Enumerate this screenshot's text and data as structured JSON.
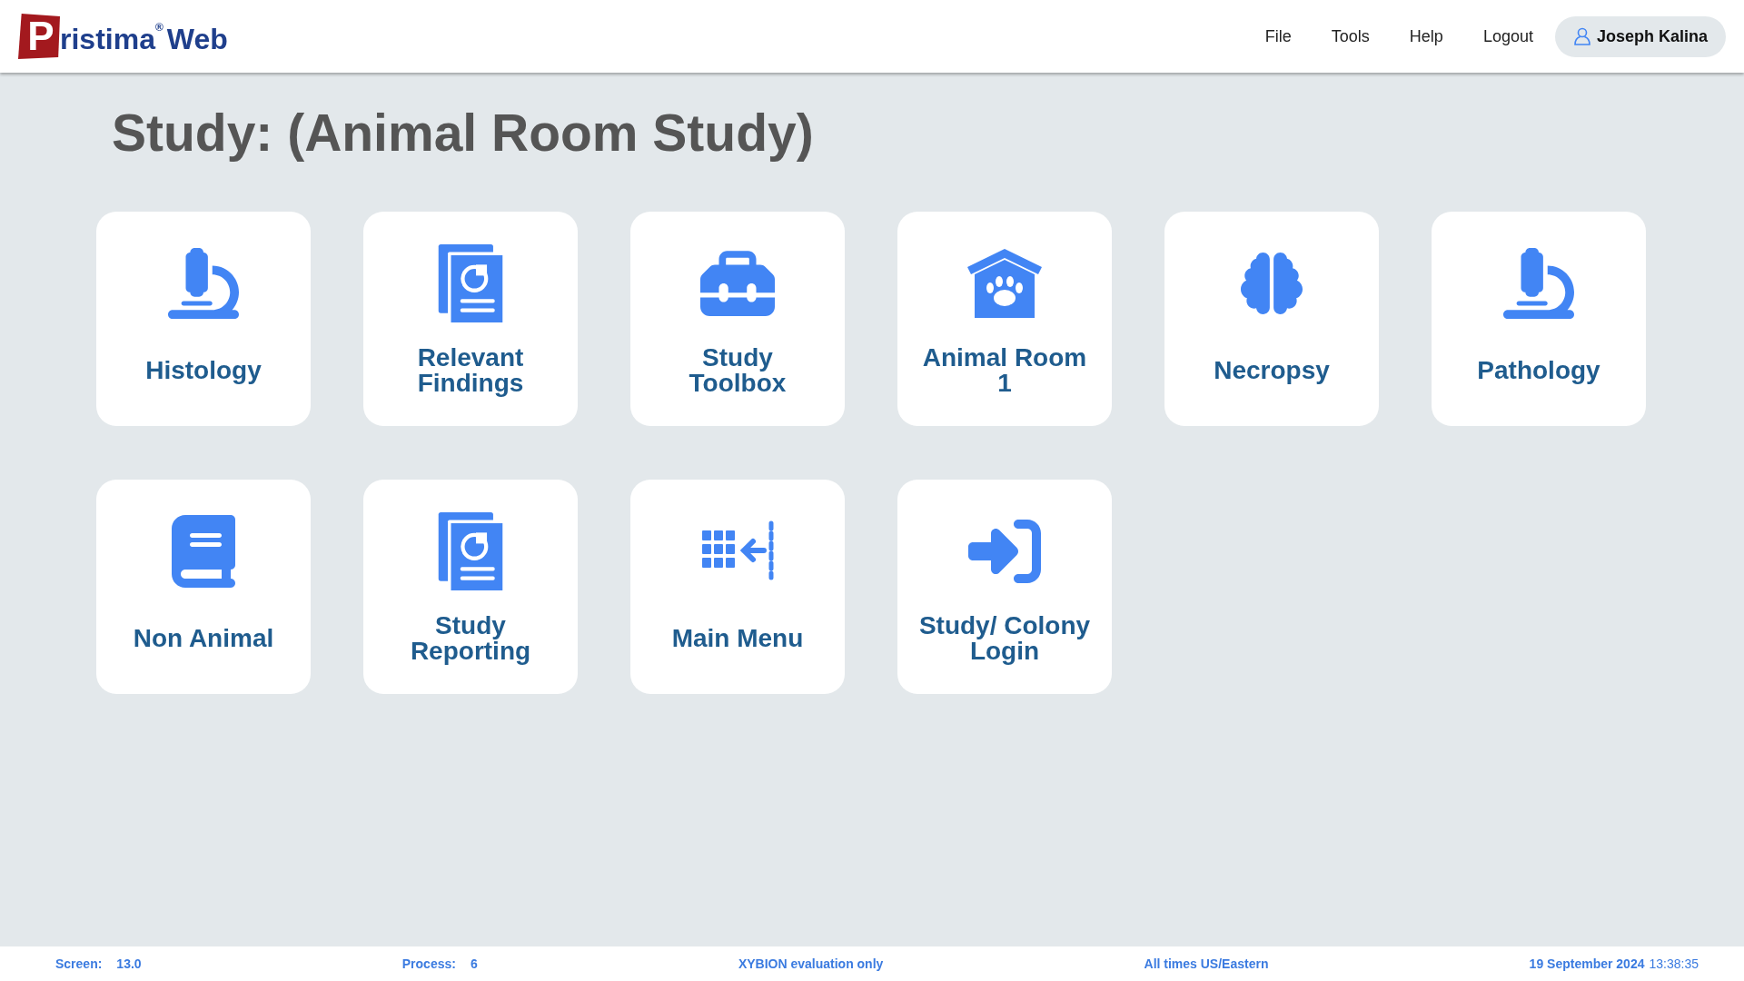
{
  "logo": {
    "mark": "P",
    "name": "ristima",
    "reg": "®",
    "suffix": "Web"
  },
  "menu": [
    {
      "label": "File"
    },
    {
      "label": "Tools"
    },
    {
      "label": "Help"
    },
    {
      "label": "Logout"
    }
  ],
  "user": {
    "name": "Joseph Kalina"
  },
  "title": "Study: (Animal Room Study)",
  "tiles": [
    {
      "label": "Histology",
      "kind": "microscope"
    },
    {
      "label": "Relevant Findings",
      "kind": "report"
    },
    {
      "label": "Study Toolbox",
      "kind": "toolbox"
    },
    {
      "label": "Animal Room 1",
      "kind": "pethouse"
    },
    {
      "label": "Necropsy",
      "kind": "brain"
    },
    {
      "label": "Pathology",
      "kind": "microscope"
    },
    {
      "label": "Non Animal",
      "kind": "book"
    },
    {
      "label": "Study Reporting",
      "kind": "report"
    },
    {
      "label": "Main Menu",
      "kind": "grid"
    },
    {
      "label": "Study/ Colony Login",
      "kind": "login"
    }
  ],
  "status_bar": [
    {
      "kind": "pair",
      "label": "Screen:",
      "value": "13.0"
    },
    {
      "kind": "pair",
      "label": "Process:",
      "value": "6"
    },
    {
      "kind": "text",
      "text": "XYBION evaluation only"
    },
    {
      "kind": "text",
      "text": "All times US/Eastern"
    },
    {
      "kind": "datetime",
      "date": "19 September 2024",
      "time": "13:38:35"
    }
  ]
}
